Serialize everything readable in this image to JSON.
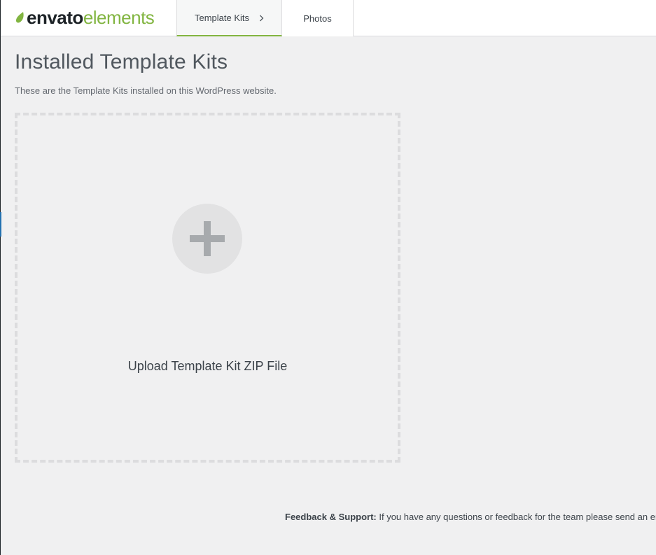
{
  "logo": {
    "brand": "envato",
    "product": "elements",
    "icon": "leaf-icon"
  },
  "tabs": [
    {
      "label": "Template Kits",
      "active": true,
      "icon": "chevron-right-icon"
    },
    {
      "label": "Photos",
      "active": false
    }
  ],
  "page": {
    "title": "Installed Template Kits",
    "subtitle": "These are the Template Kits installed on this WordPress website."
  },
  "upload": {
    "label": "Upload Template Kit ZIP File",
    "icon": "plus-icon"
  },
  "footer": {
    "heading": "Feedback & Support:",
    "text": " If you have any questions or feedback for the team please send an email"
  },
  "colors": {
    "accent": "#82b541",
    "background": "#f0f0f1",
    "admin_bar": "#1d2327",
    "admin_accent": "#2271b1"
  }
}
